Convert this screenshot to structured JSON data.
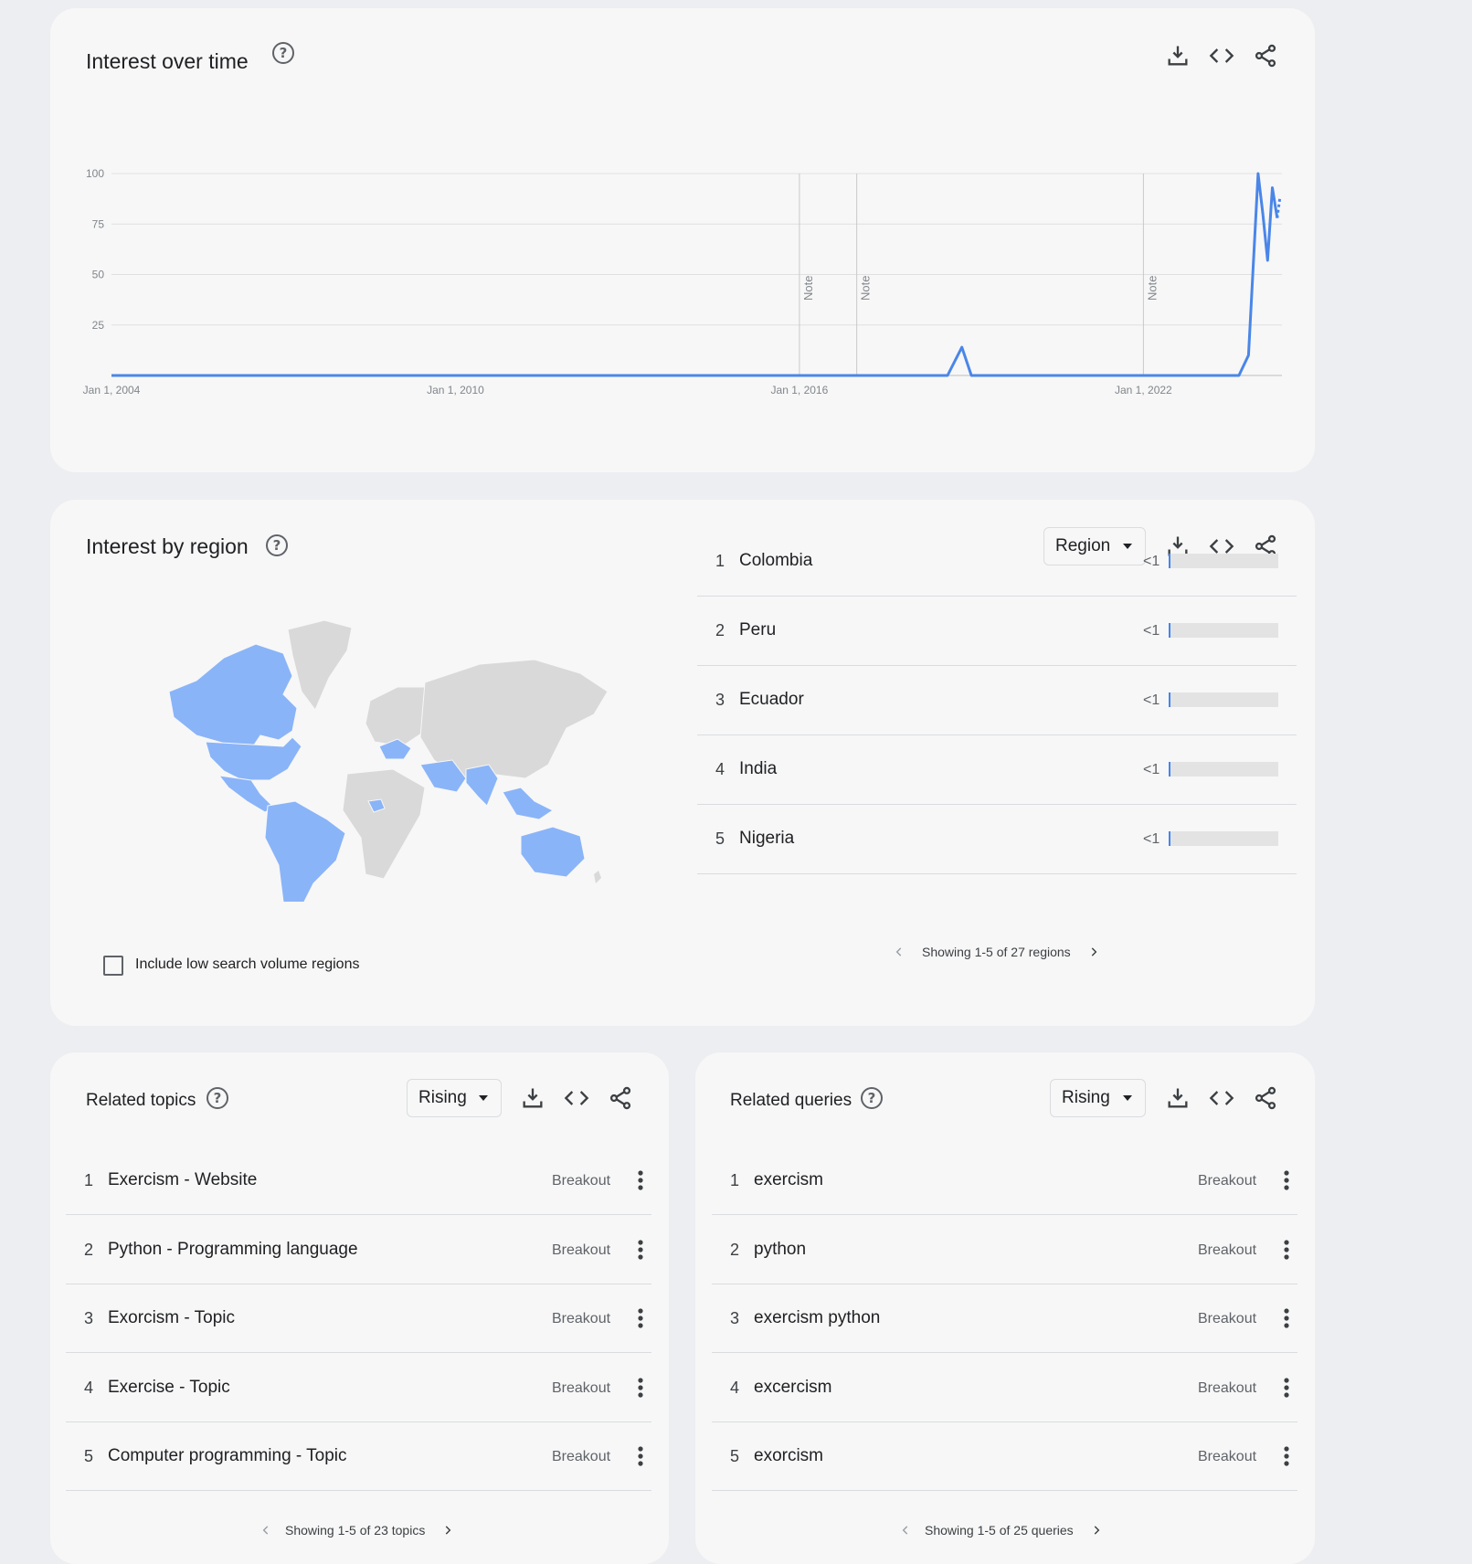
{
  "interest_over_time": {
    "title": "Interest over time",
    "help_icon": "help-circle-icon",
    "tools": [
      "download-icon",
      "embed-code-icon",
      "share-icon"
    ],
    "notes": [
      "Note",
      "Note",
      "Note"
    ],
    "chart_data": {
      "type": "line",
      "title": "",
      "xlabel": "",
      "ylabel": "",
      "x_tick_labels": [
        "Jan 1, 2004",
        "Jan 1, 2010",
        "Jan 1, 2016",
        "Jan 1, 2022"
      ],
      "y_tick_labels": [
        "100",
        "75",
        "50",
        "25"
      ],
      "ylim": [
        0,
        100
      ],
      "xlim": [
        "2004-01",
        "2024-06"
      ],
      "grid": true,
      "color": "#4a86e8",
      "series": [
        {
          "values": [
            [
              "2004-01",
              0
            ],
            [
              "2018-08",
              0
            ],
            [
              "2018-11",
              14
            ],
            [
              "2019-01",
              0
            ],
            [
              "2023-09",
              0
            ],
            [
              "2023-11",
              10
            ],
            [
              "2024-01",
              100
            ],
            [
              "2024-02",
              80
            ],
            [
              "2024-03",
              57
            ],
            [
              "2024-04",
              93
            ],
            [
              "2024-05",
              78
            ]
          ]
        }
      ],
      "notes_at": [
        "2016-01",
        "2017-01",
        "2022-01"
      ]
    }
  },
  "interest_by_region": {
    "title": "Interest by region",
    "dropdown_label": "Region",
    "regions": [
      {
        "rank": "1",
        "name": "Colombia",
        "value": "<1"
      },
      {
        "rank": "2",
        "name": "Peru",
        "value": "<1"
      },
      {
        "rank": "3",
        "name": "Ecuador",
        "value": "<1"
      },
      {
        "rank": "4",
        "name": "India",
        "value": "<1"
      },
      {
        "rank": "5",
        "name": "Nigeria",
        "value": "<1"
      }
    ],
    "checkbox_label": "Include low search volume regions",
    "pager_text": "Showing 1-5 of 27 regions",
    "map_colors": {
      "highlight": "#8ab4f8",
      "base": "#d9d9d9"
    }
  },
  "related_topics": {
    "title": "Related topics",
    "dropdown_label": "Rising",
    "items": [
      {
        "rank": "1",
        "name": "Exercism - Website",
        "value": "Breakout"
      },
      {
        "rank": "2",
        "name": "Python - Programming language",
        "value": "Breakout"
      },
      {
        "rank": "3",
        "name": "Exorcism - Topic",
        "value": "Breakout"
      },
      {
        "rank": "4",
        "name": "Exercise - Topic",
        "value": "Breakout"
      },
      {
        "rank": "5",
        "name": "Computer programming - Topic",
        "value": "Breakout"
      }
    ],
    "pager_text": "Showing 1-5 of 23 topics"
  },
  "related_queries": {
    "title": "Related queries",
    "dropdown_label": "Rising",
    "items": [
      {
        "rank": "1",
        "name": "exercism",
        "value": "Breakout"
      },
      {
        "rank": "2",
        "name": "python",
        "value": "Breakout"
      },
      {
        "rank": "3",
        "name": "exercism python",
        "value": "Breakout"
      },
      {
        "rank": "4",
        "name": "excercism",
        "value": "Breakout"
      },
      {
        "rank": "5",
        "name": "exorcism",
        "value": "Breakout"
      }
    ],
    "pager_text": "Showing 1-5 of 25 queries"
  }
}
